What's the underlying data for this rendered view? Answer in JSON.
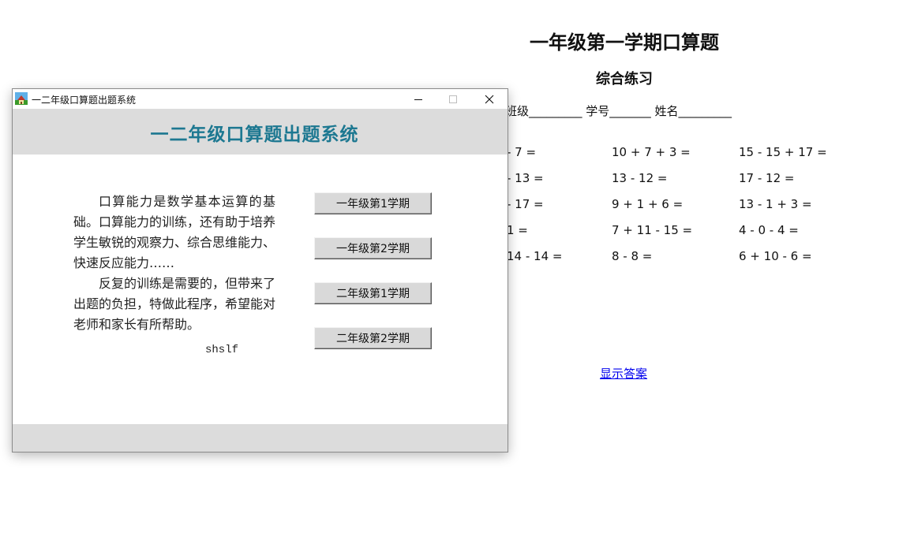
{
  "worksheet": {
    "title": "一年级第一学期口算题",
    "subtitle": "综合练习",
    "info": "班级_________ 学号_______ 姓名_________",
    "problems": [
      [
        "- 7 =",
        "10 + 7 + 3 =",
        "15 - 15 + 17 ="
      ],
      [
        "- 13 =",
        "13 - 12 =",
        "17 - 12 ="
      ],
      [
        "- 17 =",
        "9 + 1 + 6 =",
        "13 - 1 + 3 ="
      ],
      [
        "1 =",
        "7 + 11 - 15 =",
        "4 - 0 - 4 ="
      ],
      [
        "14 - 14 =",
        "8 - 8 =",
        "6 + 10 - 6 ="
      ]
    ],
    "show_answer_link": "显示答案"
  },
  "window": {
    "title": "一二年级口算题出题系统",
    "header": "一二年级口算题出题系统",
    "intro_p1": "口算能力是数学基本运算的基础。口算能力的训练，还有助于培养学生敏锐的观察力、综合思维能力、快速反应能力……",
    "intro_p2": "反复的训练是需要的，但带来了出题的负担，特做此程序，希望能对老师和家长有所帮助。",
    "author": "shslf",
    "buttons": [
      {
        "label": "一年级第1学期"
      },
      {
        "label": "一年级第2学期"
      },
      {
        "label": "二年级第1学期"
      },
      {
        "label": "二年级第2学期"
      }
    ]
  },
  "colors": {
    "header_text": "#1d7891",
    "band": "#dcdcdc",
    "link": "#0000ee"
  }
}
